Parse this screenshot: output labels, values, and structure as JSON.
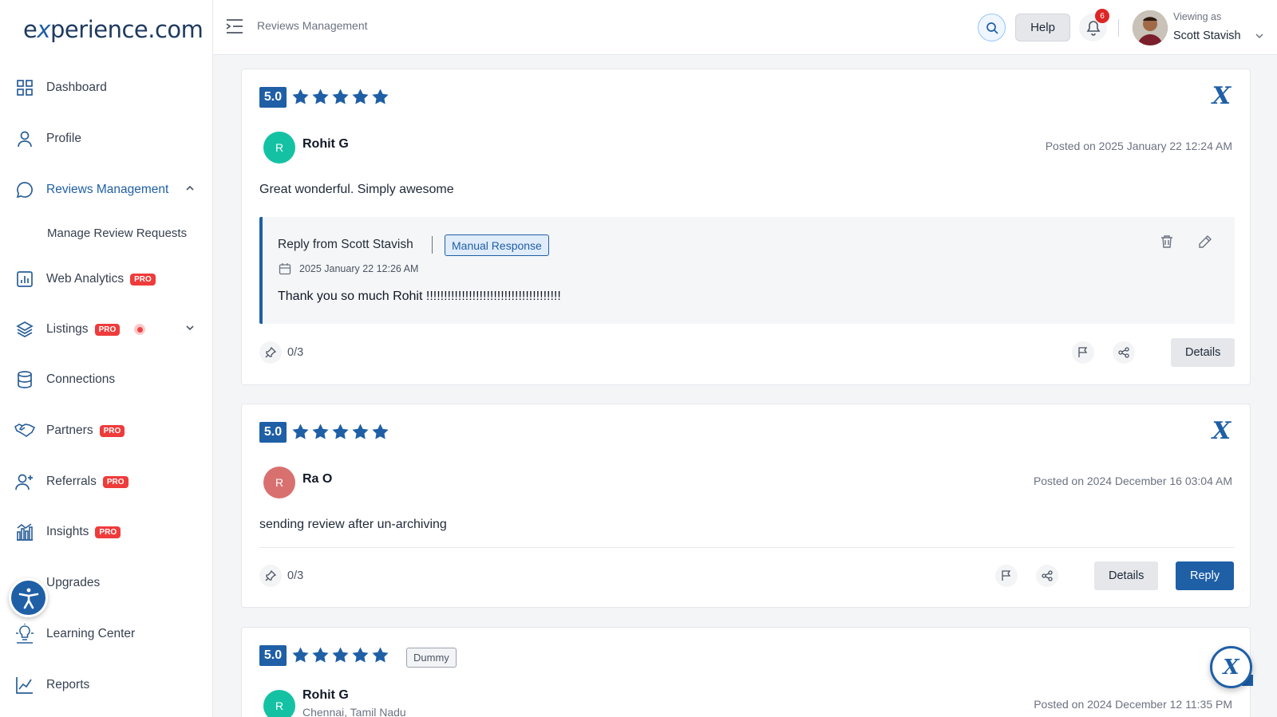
{
  "brand": {
    "logo_pre": "e",
    "logo_x": "x",
    "logo_post": "perience.com"
  },
  "sidebar": {
    "items": [
      {
        "label": "Dashboard",
        "icon": "grid-icon"
      },
      {
        "label": "Profile",
        "icon": "user-icon"
      },
      {
        "label": "Reviews Management",
        "icon": "chat-icon",
        "active": true
      },
      {
        "label": "Web Analytics",
        "icon": "bar-chart-icon",
        "badge": "PRO"
      },
      {
        "label": "Listings",
        "icon": "layers-icon",
        "badge": "PRO"
      },
      {
        "label": "Connections",
        "icon": "database-icon"
      },
      {
        "label": "Partners",
        "icon": "handshake-icon",
        "badge": "PRO"
      },
      {
        "label": "Referrals",
        "icon": "user-plus-icon",
        "badge": "PRO"
      },
      {
        "label": "Insights",
        "icon": "insights-icon",
        "badge": "PRO"
      },
      {
        "label": "Upgrades",
        "icon": "upgrade-icon"
      },
      {
        "label": "Learning Center",
        "icon": "lightbulb-icon"
      },
      {
        "label": "Reports",
        "icon": "line-chart-icon"
      }
    ],
    "sub_item": "Manage Review Requests"
  },
  "header": {
    "breadcrumb": "Reviews Management",
    "help_label": "Help",
    "notification_count": "6",
    "viewing_as": "Viewing as",
    "user_name": "Scott Stavish"
  },
  "reviews": [
    {
      "score": "5.0",
      "stars": 5,
      "initial": "R",
      "avatar_color": "#14c2a3",
      "name": "Rohit G",
      "posted": "Posted on 2025 January 22 12:24 AM",
      "text": "Great wonderful. Simply awesome",
      "reply": {
        "from": "Reply from Scott Stavish",
        "tag": "Manual Response",
        "date": "2025 January 22 12:26 AM",
        "message": "Thank you so much Rohit !!!!!!!!!!!!!!!!!!!!!!!!!!!!!!!!!!!!!!"
      },
      "pin_count": "0/3",
      "details_label": "Details"
    },
    {
      "score": "5.0",
      "stars": 5,
      "initial": "R",
      "avatar_color": "#d97070",
      "name": "Ra O",
      "posted": "Posted on 2024 December 16 03:04 AM",
      "text": "sending review after un-archiving",
      "pin_count": "0/3",
      "details_label": "Details",
      "reply_label": "Reply"
    },
    {
      "score": "5.0",
      "stars": 5,
      "tag": "Dummy",
      "initial": "R",
      "avatar_color": "#14c2a3",
      "name": "Rohit G",
      "location": "Chennai, Tamil Nadu",
      "posted": "Posted on 2024 December 12 11:35 PM"
    }
  ],
  "colors": {
    "accent": "#1f5fa6",
    "pro_badge": "#ef3b3b",
    "notification": "#dc2626"
  }
}
